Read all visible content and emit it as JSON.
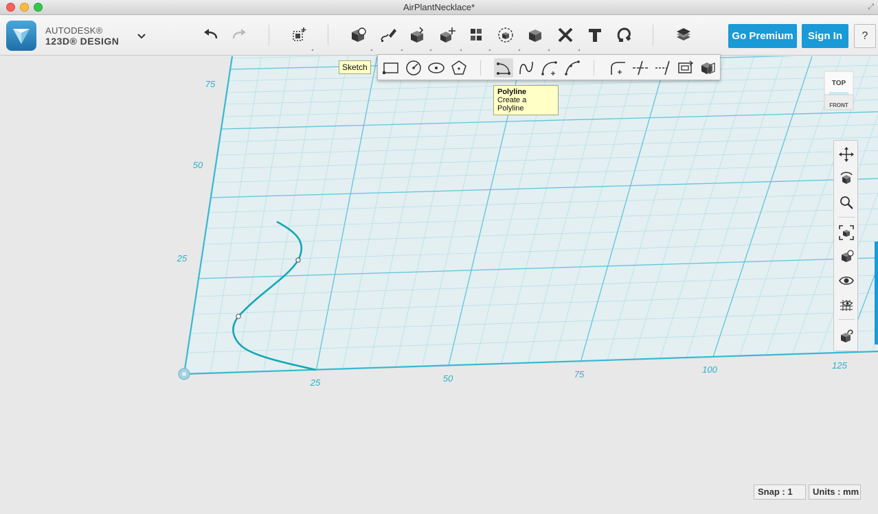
{
  "window": {
    "title": "AirPlantNecklace*"
  },
  "brand": {
    "line1": "AUTODESK®",
    "line2": "123D® DESIGN"
  },
  "account": {
    "premium_label": "Go Premium",
    "signin_label": "Sign In",
    "help_label": "?"
  },
  "colors": {
    "accent": "#1a9ad6",
    "grid_major": "#5ec5dc",
    "grid_minor": "#a9dbe6",
    "curve": "#13a6b4",
    "canvas_bg": "#e3eff1"
  },
  "tooltips": {
    "sketch": "Sketch",
    "polyline_title": "Polyline",
    "polyline_desc": "Create a Polyline"
  },
  "sketch_tools": [
    "sketch-rectangle-icon",
    "sketch-circle-icon",
    "sketch-ellipse-icon",
    "sketch-polygon-icon",
    "polyline-icon",
    "spline-icon",
    "two-point-arc-icon",
    "three-point-arc-icon",
    "fillet-icon",
    "trim-icon",
    "extend-icon",
    "offset-icon",
    "project-icon"
  ],
  "main_tools": [
    "undo-icon",
    "redo-icon",
    "transform-icon",
    "primitives-icon",
    "sketch-icon",
    "construct-icon",
    "modify-icon",
    "pattern-icon",
    "grouping-icon",
    "combine-icon",
    "measure-icon",
    "text-icon",
    "snap-icon",
    "material-icon"
  ],
  "axis": {
    "x_labels": [
      "25",
      "50",
      "75",
      "100",
      "125"
    ],
    "y_labels": [
      "25",
      "50",
      "75"
    ]
  },
  "viewcube": {
    "top": "TOP",
    "front": "FRONT"
  },
  "status": {
    "snap": "Snap : 1",
    "units": "Units : mm"
  }
}
